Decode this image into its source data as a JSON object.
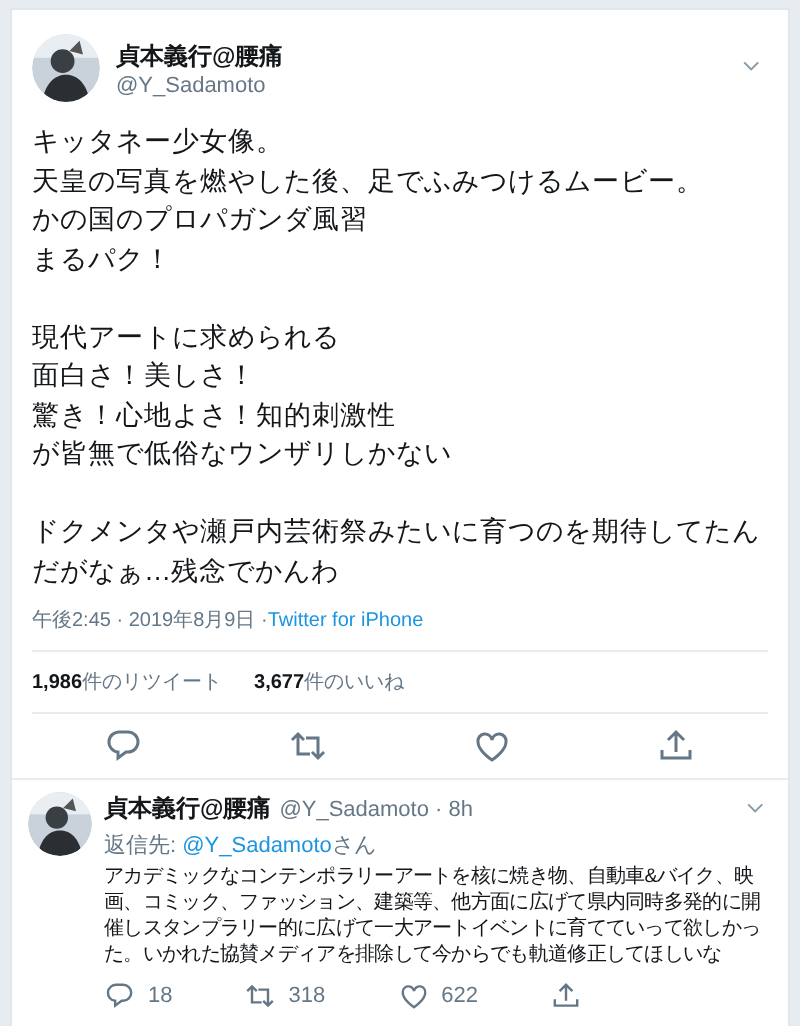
{
  "tweet": {
    "name": "貞本義行@腰痛",
    "handle": "@Y_Sadamoto",
    "paragraphs": [
      [
        "キッタネー少女像。",
        "天皇の写真を燃やした後、足でふみつけるムービー。",
        "かの国のプロパガンダ風習",
        "まるパク！"
      ],
      [
        "現代アートに求められる",
        "面白さ！美しさ！",
        "驚き！心地よさ！知的刺激性",
        "が皆無で低俗なウンザリしかない"
      ],
      [
        "ドクメンタや瀬戸内芸術祭みたいに育つのを期待してたんだがなぁ…残念でかんわ"
      ]
    ],
    "time": "午後2:45 · 2019年8月9日 · ",
    "source": "Twitter for iPhone",
    "stats": [
      "**1,986**件のリツイート",
      "**3,677**件のいいね"
    ]
  },
  "reply": {
    "name": "貞本義行@腰痛",
    "handle": "@Y_Sadamoto",
    "age": " · 8h",
    "reply_to_prefix": "返信先: ",
    "reply_to": "@Y_Sadamoto",
    "reply_to_suffix": "さん",
    "text": "アカデミックなコンテンポラリーアートを核に焼き物、自動車&バイク、映画、コミック、ファッション、建築等、他方面に広げて県内同時多発的に開催しスタンプラリー的に広げて一大アートイベントに育てていって欲しかった。いかれた協賛メディアを排除して今からでも軌道修正してほしいな",
    "counts": {
      "replies": "18",
      "retweets": "318",
      "likes": "622"
    }
  }
}
